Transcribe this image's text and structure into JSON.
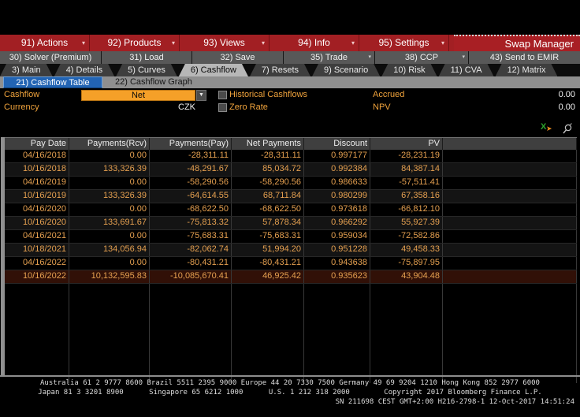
{
  "menubar": {
    "items": [
      {
        "label": "91) Actions"
      },
      {
        "label": "92) Products"
      },
      {
        "label": "93) Views"
      },
      {
        "label": "94) Info"
      },
      {
        "label": "95) Settings"
      }
    ],
    "app_title": "Swap Manager"
  },
  "toolbar": {
    "buttons": [
      {
        "label": "30) Solver (Premium)"
      },
      {
        "label": "31) Load"
      },
      {
        "label": "32) Save"
      },
      {
        "label": "35) Trade",
        "caret": true
      },
      {
        "label": "38) CCP",
        "caret": true
      },
      {
        "label": "43) Send to EMIR"
      }
    ]
  },
  "tabs": {
    "items": [
      {
        "label": "3) Main"
      },
      {
        "label": "4) Details"
      },
      {
        "label": "5) Curves"
      },
      {
        "label": "6) Cashflow",
        "selected": true
      },
      {
        "label": "7) Resets"
      },
      {
        "label": "9) Scenario"
      },
      {
        "label": "10) Risk"
      },
      {
        "label": "11) CVA"
      },
      {
        "label": "12) Matrix"
      }
    ]
  },
  "subtabs": {
    "table_label": "21) Cashflow Table",
    "graph_label": "22) Cashflow Graph"
  },
  "form": {
    "cashflow_label": "Cashflow",
    "cashflow_value": "Net",
    "currency_label": "Currency",
    "currency_value": "CZK",
    "historical_label": "Historical Cashflows",
    "zero_rate_label": "Zero Rate",
    "accrued_label": "Accrued",
    "accrued_value": "0.00",
    "npv_label": "NPV",
    "npv_value": "0.00"
  },
  "table": {
    "columns": [
      {
        "label": "Pay Date"
      },
      {
        "label": "Payments(Rcv)"
      },
      {
        "label": "Payments(Pay)"
      },
      {
        "label": "Net Payments"
      },
      {
        "label": "Discount"
      },
      {
        "label": "PV"
      }
    ],
    "rows": [
      {
        "date": "04/16/2018",
        "rcv": "0.00",
        "pay": "-28,311.11",
        "net": "-28,311.11",
        "disc": "0.997177",
        "pv": "-28,231.19"
      },
      {
        "date": "10/16/2018",
        "rcv": "133,326.39",
        "pay": "-48,291.67",
        "net": "85,034.72",
        "disc": "0.992384",
        "pv": "84,387.14"
      },
      {
        "date": "04/16/2019",
        "rcv": "0.00",
        "pay": "-58,290.56",
        "net": "-58,290.56",
        "disc": "0.986633",
        "pv": "-57,511.41"
      },
      {
        "date": "10/16/2019",
        "rcv": "133,326.39",
        "pay": "-64,614.55",
        "net": "68,711.84",
        "disc": "0.980299",
        "pv": "67,358.16"
      },
      {
        "date": "04/16/2020",
        "rcv": "0.00",
        "pay": "-68,622.50",
        "net": "-68,622.50",
        "disc": "0.973618",
        "pv": "-66,812.10"
      },
      {
        "date": "10/16/2020",
        "rcv": "133,691.67",
        "pay": "-75,813.32",
        "net": "57,878.34",
        "disc": "0.966292",
        "pv": "55,927.39"
      },
      {
        "date": "04/16/2021",
        "rcv": "0.00",
        "pay": "-75,683.31",
        "net": "-75,683.31",
        "disc": "0.959034",
        "pv": "-72,582.86"
      },
      {
        "date": "10/18/2021",
        "rcv": "134,056.94",
        "pay": "-82,062.74",
        "net": "51,994.20",
        "disc": "0.951228",
        "pv": "49,458.33"
      },
      {
        "date": "04/16/2022",
        "rcv": "0.00",
        "pay": "-80,431.21",
        "net": "-80,431.21",
        "disc": "0.943638",
        "pv": "-75,897.95"
      },
      {
        "date": "10/16/2022",
        "rcv": "10,132,595.83",
        "pay": "-10,085,670.41",
        "net": "46,925.42",
        "disc": "0.935623",
        "pv": "43,904.48",
        "hl": true
      }
    ]
  },
  "footer": {
    "line1": "Australia 61 2 9777 8600 Brazil 5511 2395 9000 Europe 44 20 7330 7500 Germany 49 69 9204 1210 Hong Kong 852 2977 6000",
    "line2": "Japan 81 3 3201 8900      Singapore 65 6212 1000      U.S. 1 212 318 2000        Copyright 2017 Bloomberg Finance L.P.",
    "line3": "SN 211698 CEST GMT+2:00 H216-2798-1 12-Oct-2017 14:51:24"
  },
  "colors": {
    "menu_red": "#a21f23",
    "toolbar_gray": "#585858",
    "subtab_blue": "#2264b4",
    "amber_label": "#f0a33c",
    "amber_field": "#f5a028",
    "table_text": "#e5a050",
    "row_highlight": "#311007"
  }
}
